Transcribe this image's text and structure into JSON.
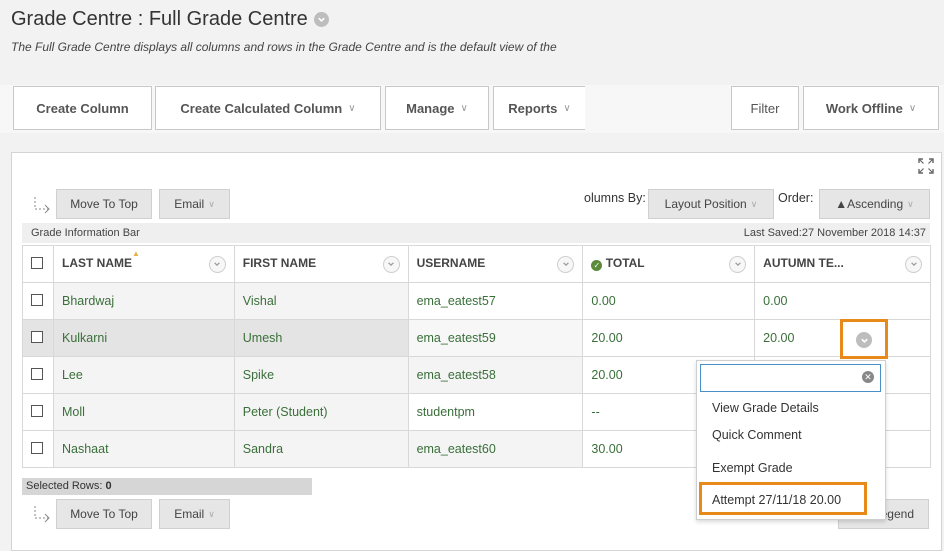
{
  "page": {
    "title": "Grade Centre : Full Grade Centre",
    "subtitle": "The Full Grade Centre displays all columns and rows in the Grade Centre and is the default view of the"
  },
  "toolbar": {
    "create_column": "Create Column",
    "create_calculated_column": "Create Calculated Column",
    "manage": "Manage",
    "reports": "Reports",
    "filter": "Filter",
    "work_offline": "Work Offline"
  },
  "grid_controls": {
    "move_to_top": "Move To Top",
    "email": "Email",
    "sort_columns_by_label": "olumns By:",
    "sort_columns_by_value": "Layout Position",
    "order_label": "Order:",
    "order_value": "▲Ascending"
  },
  "info_bar": {
    "label": "Grade Information Bar",
    "last_saved": "Last Saved:27 November 2018 14:37"
  },
  "table": {
    "headers": [
      "LAST NAME",
      "FIRST NAME",
      "USERNAME",
      "TOTAL",
      "AUTUMN TE..."
    ],
    "rows": [
      {
        "last": "Bhardwaj",
        "first": "Vishal",
        "username": "ema_eatest57",
        "total": "0.00",
        "autumn": "0.00"
      },
      {
        "last": "Kulkarni",
        "first": "Umesh",
        "username": "ema_eatest59",
        "total": "20.00",
        "autumn": "20.00"
      },
      {
        "last": "Lee",
        "first": "Spike",
        "username": "ema_eatest58",
        "total": "20.00",
        "autumn": ""
      },
      {
        "last": "Moll",
        "first": "Peter (Student)",
        "username": "studentpm",
        "total": "--",
        "autumn": ""
      },
      {
        "last": "Nashaat",
        "first": "Sandra",
        "username": "ema_eatest60",
        "total": "30.00",
        "autumn": ""
      }
    ]
  },
  "context_menu": {
    "items": [
      "View Grade Details",
      "Quick Comment",
      "Exempt Grade",
      "Attempt 27/11/18 20.00"
    ]
  },
  "footer": {
    "selected_rows_label": "Selected Rows:",
    "selected_rows_count": "0",
    "legend_partial": "egend"
  },
  "colors": {
    "accent_orange": "#e88a1a",
    "link_green": "#3a6f3a"
  }
}
